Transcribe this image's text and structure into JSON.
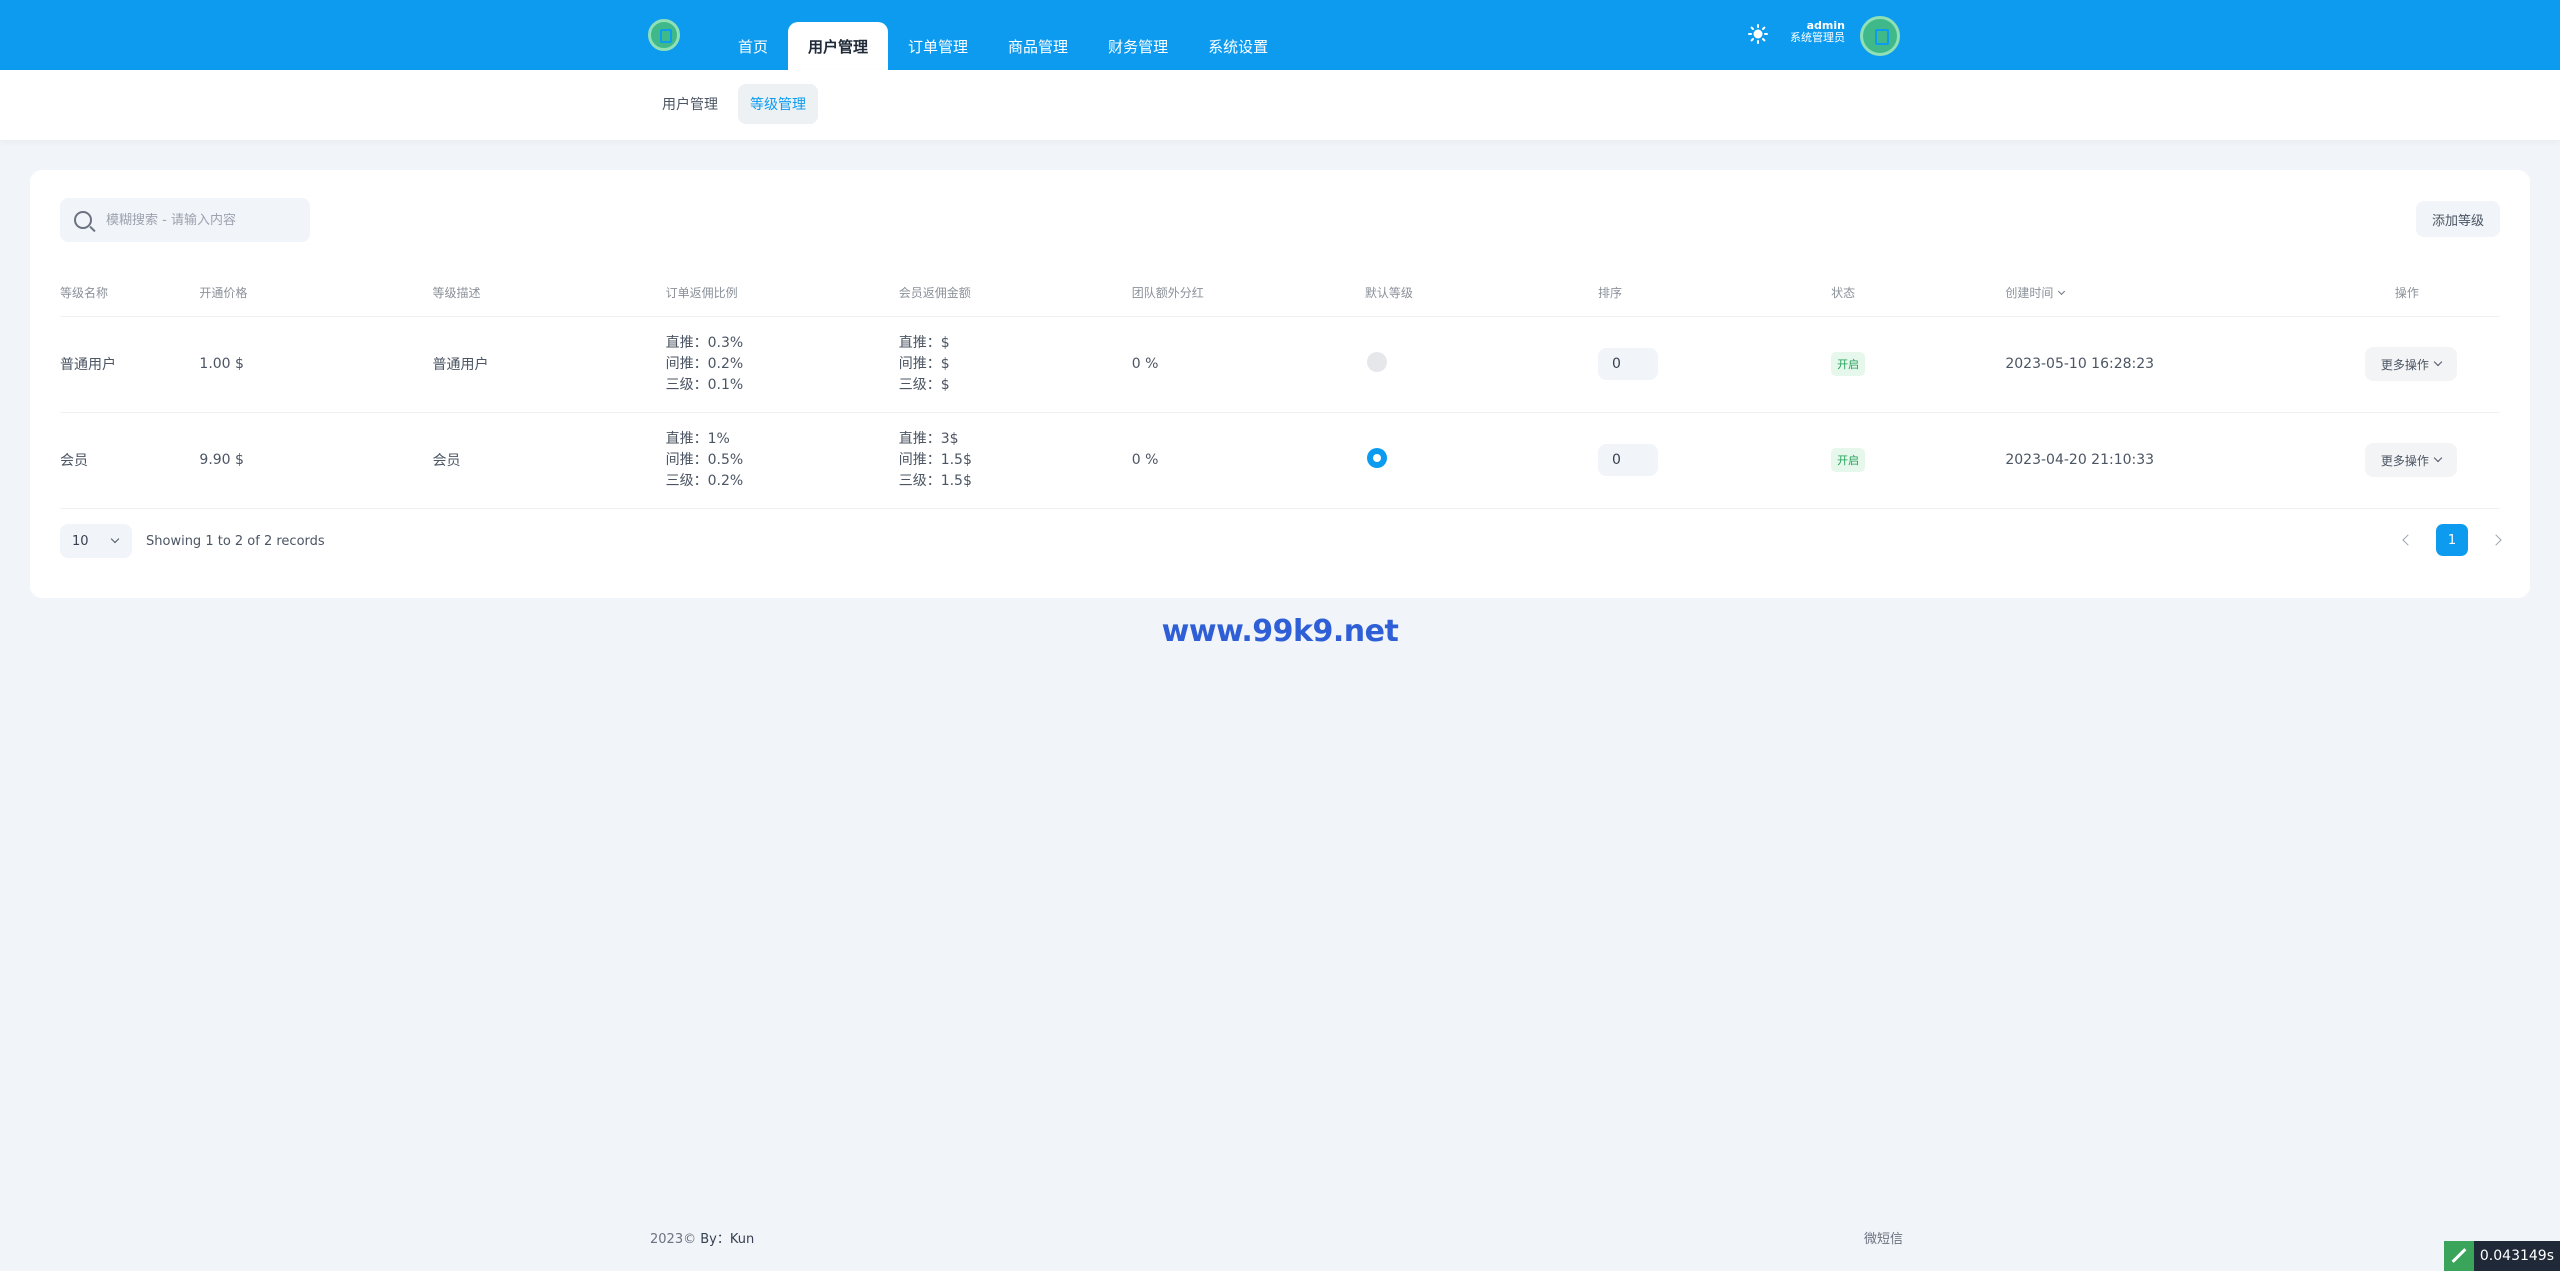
{
  "header": {
    "nav": [
      "首页",
      "用户管理",
      "订单管理",
      "商品管理",
      "财务管理",
      "系统设置"
    ],
    "active_nav": "用户管理",
    "user_name": "admin",
    "user_role": "系统管理员"
  },
  "subnav": {
    "items": [
      "用户管理",
      "等级管理"
    ],
    "active": "等级管理"
  },
  "toolbar": {
    "search_placeholder": "模糊搜索 - 请输入内容",
    "add_label": "添加等级"
  },
  "table": {
    "columns": [
      "等级名称",
      "开通价格",
      "等级描述",
      "订单返佣比例",
      "会员返佣金额",
      "团队额外分红",
      "默认等级",
      "排序",
      "状态",
      "创建时间",
      "操作"
    ],
    "rows": [
      {
        "name": "普通用户",
        "price": "1.00 $",
        "desc": "普通用户",
        "order_rates": [
          "直推：0.3%",
          "间推：0.2%",
          "三级：0.1%"
        ],
        "member_amounts": [
          "直推：$",
          "间推：$",
          "三级：$"
        ],
        "team_bonus": "0 %",
        "default": false,
        "sort": "0",
        "status": "开启",
        "created": "2023-05-10 16:28:23",
        "action": "更多操作"
      },
      {
        "name": "会员",
        "price": "9.90 $",
        "desc": "会员",
        "order_rates": [
          "直推：1%",
          "间推：0.5%",
          "三级：0.2%"
        ],
        "member_amounts": [
          "直推：3$",
          "间推：1.5$",
          "三级：1.5$"
        ],
        "team_bonus": "0 %",
        "default": true,
        "sort": "0",
        "status": "开启",
        "created": "2023-04-20 21:10:33",
        "action": "更多操作"
      }
    ]
  },
  "pagination": {
    "page_size": "10",
    "records_text": "Showing 1 to 2 of 2 records",
    "current_page": "1"
  },
  "watermark": "www.99k9.net",
  "footer": {
    "copyright": "2023©",
    "by": "By：Kun",
    "right": "微短信"
  },
  "timer": "0.043149s",
  "colors": {
    "primary": "#0c9bef",
    "status_green": "#22a35a"
  }
}
